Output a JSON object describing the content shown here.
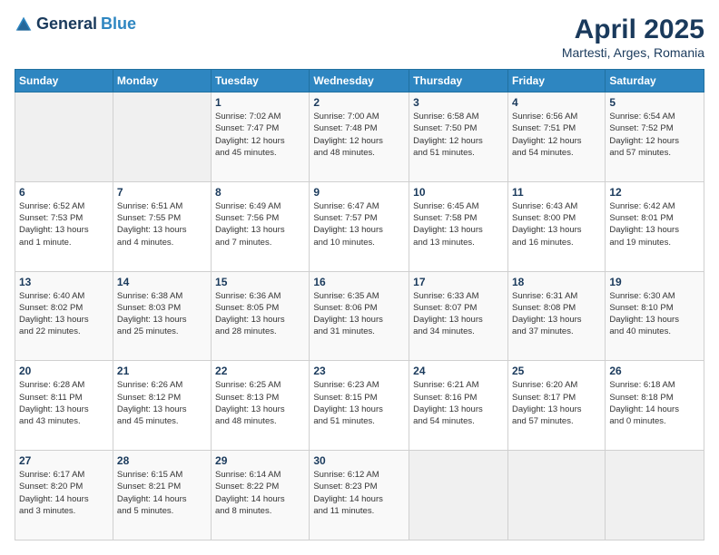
{
  "header": {
    "logo_general": "General",
    "logo_blue": "Blue",
    "main_title": "April 2025",
    "subtitle": "Martesti, Arges, Romania"
  },
  "calendar": {
    "days_of_week": [
      "Sunday",
      "Monday",
      "Tuesday",
      "Wednesday",
      "Thursday",
      "Friday",
      "Saturday"
    ],
    "weeks": [
      [
        {
          "day": "",
          "detail": ""
        },
        {
          "day": "",
          "detail": ""
        },
        {
          "day": "1",
          "detail": "Sunrise: 7:02 AM\nSunset: 7:47 PM\nDaylight: 12 hours\nand 45 minutes."
        },
        {
          "day": "2",
          "detail": "Sunrise: 7:00 AM\nSunset: 7:48 PM\nDaylight: 12 hours\nand 48 minutes."
        },
        {
          "day": "3",
          "detail": "Sunrise: 6:58 AM\nSunset: 7:50 PM\nDaylight: 12 hours\nand 51 minutes."
        },
        {
          "day": "4",
          "detail": "Sunrise: 6:56 AM\nSunset: 7:51 PM\nDaylight: 12 hours\nand 54 minutes."
        },
        {
          "day": "5",
          "detail": "Sunrise: 6:54 AM\nSunset: 7:52 PM\nDaylight: 12 hours\nand 57 minutes."
        }
      ],
      [
        {
          "day": "6",
          "detail": "Sunrise: 6:52 AM\nSunset: 7:53 PM\nDaylight: 13 hours\nand 1 minute."
        },
        {
          "day": "7",
          "detail": "Sunrise: 6:51 AM\nSunset: 7:55 PM\nDaylight: 13 hours\nand 4 minutes."
        },
        {
          "day": "8",
          "detail": "Sunrise: 6:49 AM\nSunset: 7:56 PM\nDaylight: 13 hours\nand 7 minutes."
        },
        {
          "day": "9",
          "detail": "Sunrise: 6:47 AM\nSunset: 7:57 PM\nDaylight: 13 hours\nand 10 minutes."
        },
        {
          "day": "10",
          "detail": "Sunrise: 6:45 AM\nSunset: 7:58 PM\nDaylight: 13 hours\nand 13 minutes."
        },
        {
          "day": "11",
          "detail": "Sunrise: 6:43 AM\nSunset: 8:00 PM\nDaylight: 13 hours\nand 16 minutes."
        },
        {
          "day": "12",
          "detail": "Sunrise: 6:42 AM\nSunset: 8:01 PM\nDaylight: 13 hours\nand 19 minutes."
        }
      ],
      [
        {
          "day": "13",
          "detail": "Sunrise: 6:40 AM\nSunset: 8:02 PM\nDaylight: 13 hours\nand 22 minutes."
        },
        {
          "day": "14",
          "detail": "Sunrise: 6:38 AM\nSunset: 8:03 PM\nDaylight: 13 hours\nand 25 minutes."
        },
        {
          "day": "15",
          "detail": "Sunrise: 6:36 AM\nSunset: 8:05 PM\nDaylight: 13 hours\nand 28 minutes."
        },
        {
          "day": "16",
          "detail": "Sunrise: 6:35 AM\nSunset: 8:06 PM\nDaylight: 13 hours\nand 31 minutes."
        },
        {
          "day": "17",
          "detail": "Sunrise: 6:33 AM\nSunset: 8:07 PM\nDaylight: 13 hours\nand 34 minutes."
        },
        {
          "day": "18",
          "detail": "Sunrise: 6:31 AM\nSunset: 8:08 PM\nDaylight: 13 hours\nand 37 minutes."
        },
        {
          "day": "19",
          "detail": "Sunrise: 6:30 AM\nSunset: 8:10 PM\nDaylight: 13 hours\nand 40 minutes."
        }
      ],
      [
        {
          "day": "20",
          "detail": "Sunrise: 6:28 AM\nSunset: 8:11 PM\nDaylight: 13 hours\nand 43 minutes."
        },
        {
          "day": "21",
          "detail": "Sunrise: 6:26 AM\nSunset: 8:12 PM\nDaylight: 13 hours\nand 45 minutes."
        },
        {
          "day": "22",
          "detail": "Sunrise: 6:25 AM\nSunset: 8:13 PM\nDaylight: 13 hours\nand 48 minutes."
        },
        {
          "day": "23",
          "detail": "Sunrise: 6:23 AM\nSunset: 8:15 PM\nDaylight: 13 hours\nand 51 minutes."
        },
        {
          "day": "24",
          "detail": "Sunrise: 6:21 AM\nSunset: 8:16 PM\nDaylight: 13 hours\nand 54 minutes."
        },
        {
          "day": "25",
          "detail": "Sunrise: 6:20 AM\nSunset: 8:17 PM\nDaylight: 13 hours\nand 57 minutes."
        },
        {
          "day": "26",
          "detail": "Sunrise: 6:18 AM\nSunset: 8:18 PM\nDaylight: 14 hours\nand 0 minutes."
        }
      ],
      [
        {
          "day": "27",
          "detail": "Sunrise: 6:17 AM\nSunset: 8:20 PM\nDaylight: 14 hours\nand 3 minutes."
        },
        {
          "day": "28",
          "detail": "Sunrise: 6:15 AM\nSunset: 8:21 PM\nDaylight: 14 hours\nand 5 minutes."
        },
        {
          "day": "29",
          "detail": "Sunrise: 6:14 AM\nSunset: 8:22 PM\nDaylight: 14 hours\nand 8 minutes."
        },
        {
          "day": "30",
          "detail": "Sunrise: 6:12 AM\nSunset: 8:23 PM\nDaylight: 14 hours\nand 11 minutes."
        },
        {
          "day": "",
          "detail": ""
        },
        {
          "day": "",
          "detail": ""
        },
        {
          "day": "",
          "detail": ""
        }
      ]
    ]
  }
}
